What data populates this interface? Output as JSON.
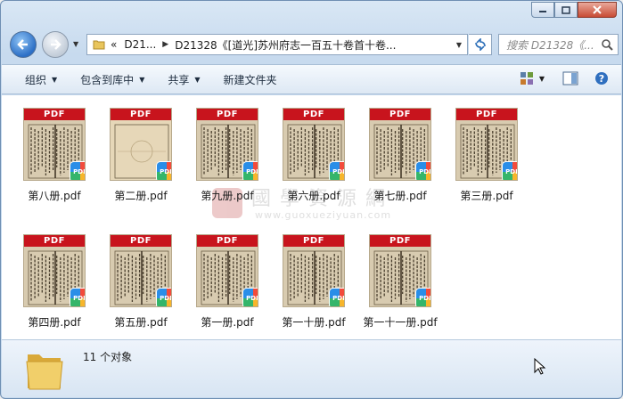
{
  "address": {
    "history_symbol": "«",
    "crumbs": [
      "D21...",
      "D21328《[道光]苏州府志一百五十卷首十卷..."
    ]
  },
  "search": {
    "placeholder": "搜索 D21328《..."
  },
  "toolbar": {
    "organize": "组织",
    "include_in_library": "包含到库中",
    "share": "共享",
    "new_folder": "新建文件夹"
  },
  "files": [
    {
      "name": "第八册.pdf",
      "banner": "PDF",
      "badge": "PDF"
    },
    {
      "name": "第二册.pdf",
      "banner": "PDF",
      "badge": "PDF"
    },
    {
      "name": "第九册.pdf",
      "banner": "PDF",
      "badge": "PDF"
    },
    {
      "name": "第六册.pdf",
      "banner": "PDF",
      "badge": "PDF"
    },
    {
      "name": "第七册.pdf",
      "banner": "PDF",
      "badge": "PDF"
    },
    {
      "name": "第三册.pdf",
      "banner": "PDF",
      "badge": "PDF"
    },
    {
      "name": "第四册.pdf",
      "banner": "PDF",
      "badge": "PDF"
    },
    {
      "name": "第五册.pdf",
      "banner": "PDF",
      "badge": "PDF"
    },
    {
      "name": "第一册.pdf",
      "banner": "PDF",
      "badge": "PDF"
    },
    {
      "name": "第一十册.pdf",
      "banner": "PDF",
      "badge": "PDF"
    },
    {
      "name": "第一十一册.pdf",
      "banner": "PDF",
      "badge": "PDF"
    }
  ],
  "watermark": {
    "title": "國學資源網",
    "url": "www.guoxueziyuan.com"
  },
  "status": {
    "count": "11 个对象"
  },
  "colors": {
    "pdf_banner": "#c8141d",
    "window_frame": "#c7daee"
  }
}
